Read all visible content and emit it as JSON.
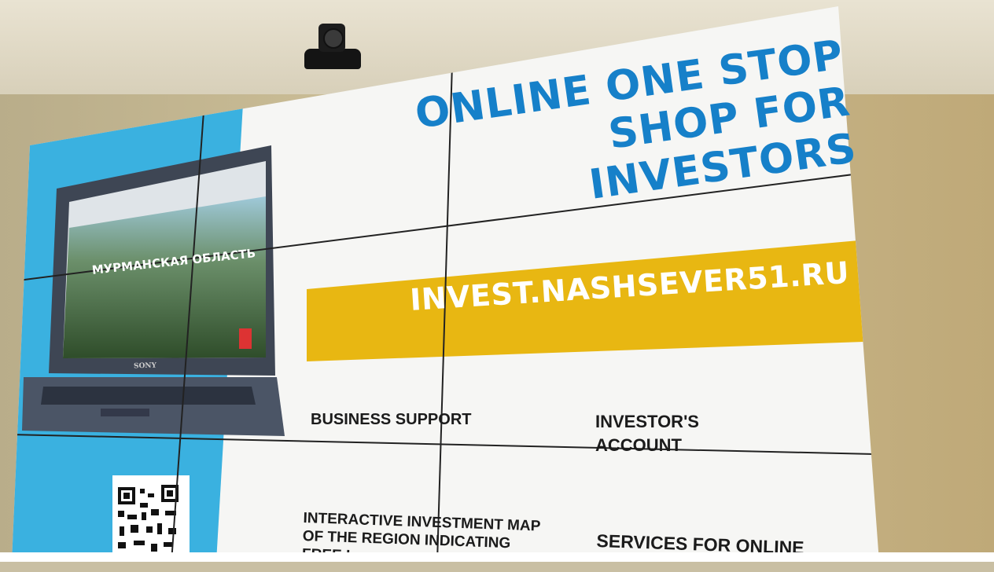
{
  "screen": {
    "headline": [
      "ONLINE ONE STOP",
      "SHOP FOR",
      "INVESTORS"
    ],
    "url": "INVEST.NASHSEVER51.RU",
    "menu": {
      "business_support": "BUSINESS SUPPORT",
      "investors_account": [
        "INVESTOR'S",
        "ACCOUNT"
      ],
      "interactive_map": [
        "INTERACTIVE INVESTMENT MAP",
        "OF THE REGION INDICATING",
        "FREE L"
      ],
      "services": "SERVICES FOR ONLINE"
    },
    "laptop": {
      "site_title": "МУРМАНСКАЯ ОБЛАСТЬ",
      "brand": "SONY"
    }
  },
  "colors": {
    "accent_blue": "#1680c9",
    "side_panel_blue": "#3ab1e0",
    "banner_yellow": "#e8b712",
    "screen_white": "#f6f6f4",
    "wall": "#c8b88e"
  },
  "icons": [
    "qr-code-icon",
    "camera-icon",
    "laptop-icon"
  ]
}
